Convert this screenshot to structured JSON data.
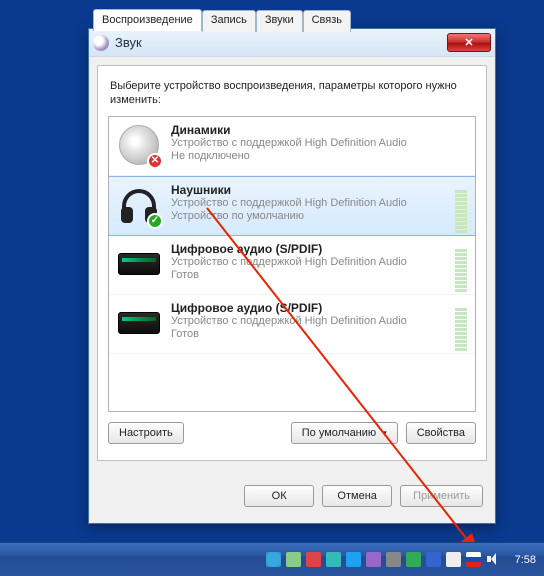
{
  "window": {
    "title": "Звук"
  },
  "tabs": [
    {
      "label": "Воспроизведение",
      "active": true
    },
    {
      "label": "Запись",
      "active": false
    },
    {
      "label": "Звуки",
      "active": false
    },
    {
      "label": "Связь",
      "active": false
    }
  ],
  "instruction": "Выберите устройство воспроизведения, параметры которого нужно изменить:",
  "devices": [
    {
      "name": "Динамики",
      "sub1": "Устройство с поддержкой High Definition Audio",
      "sub2": "Не подключено",
      "icon": "speaker",
      "badge": "x",
      "selected": false,
      "meter": false
    },
    {
      "name": "Наушники",
      "sub1": "Устройство с поддержкой High Definition Audio",
      "sub2": "Устройство по умолчанию",
      "icon": "headphones",
      "badge": "check",
      "selected": true,
      "meter": true
    },
    {
      "name": "Цифровое аудио (S/PDIF)",
      "sub1": "Устройство с поддержкой High Definition Audio",
      "sub2": "Готов",
      "icon": "spdif",
      "badge": null,
      "selected": false,
      "meter": true
    },
    {
      "name": "Цифровое аудио (S/PDIF)",
      "sub1": "Устройство с поддержкой High Definition Audio",
      "sub2": "Готов",
      "icon": "spdif",
      "badge": null,
      "selected": false,
      "meter": true
    }
  ],
  "buttons": {
    "configure": "Настроить",
    "default": "По умолчанию",
    "properties": "Свойства",
    "ok": "ОК",
    "cancel": "Отмена",
    "apply": "Применить"
  },
  "clock": "7:58",
  "tray_icons": [
    "telegram",
    "geen",
    "red",
    "cyan",
    "twit",
    "purple",
    "gray",
    "green2",
    "blue2",
    "msg",
    "flag",
    "vol"
  ]
}
